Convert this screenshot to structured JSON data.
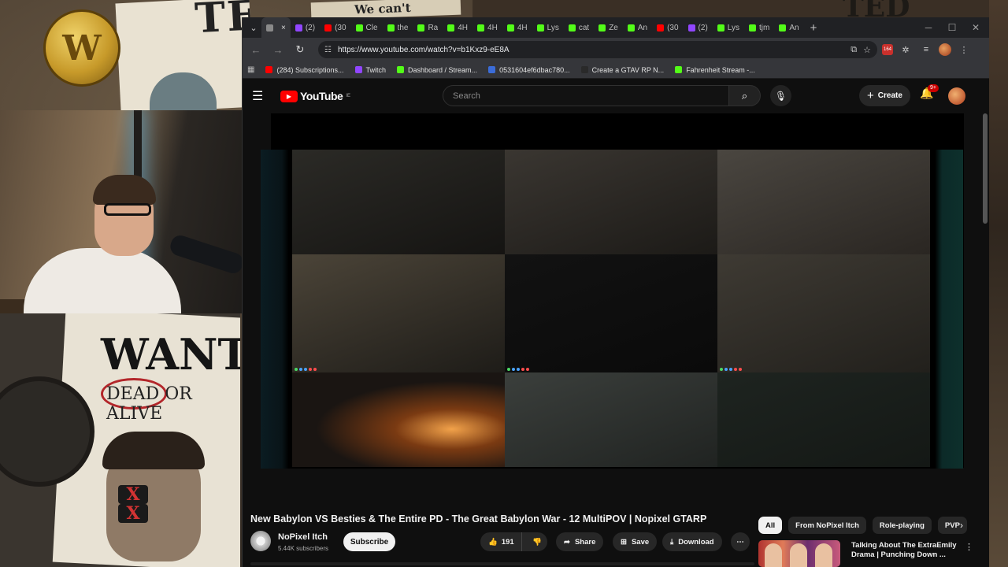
{
  "overlay": {
    "poster_top_text": "TED",
    "banner_text": "We can't expect",
    "logo_letter": "W",
    "top_right_text": "TED",
    "poster_bottom_wanted": "WANTE",
    "poster_bottom_sub": "DEAD OR ALIVE",
    "eyes_mark": "X"
  },
  "browser": {
    "tabs": [
      {
        "label": "",
        "favicon_color": "#8a8a8a",
        "active": true,
        "close": "×"
      },
      {
        "label": "(2)",
        "favicon_color": "#9146ff"
      },
      {
        "label": "(30",
        "favicon_color": "#ff0000"
      },
      {
        "label": "Cle",
        "favicon_color": "#53fc18"
      },
      {
        "label": "the",
        "favicon_color": "#53fc18"
      },
      {
        "label": "Ra",
        "favicon_color": "#53fc18"
      },
      {
        "label": "4H",
        "favicon_color": "#53fc18"
      },
      {
        "label": "4H",
        "favicon_color": "#53fc18"
      },
      {
        "label": "4H",
        "favicon_color": "#53fc18"
      },
      {
        "label": "Lys",
        "favicon_color": "#53fc18"
      },
      {
        "label": "cat",
        "favicon_color": "#53fc18"
      },
      {
        "label": "Ze",
        "favicon_color": "#53fc18"
      },
      {
        "label": "An",
        "favicon_color": "#53fc18"
      },
      {
        "label": "(30",
        "favicon_color": "#ff0000"
      },
      {
        "label": "(2)",
        "favicon_color": "#9146ff"
      },
      {
        "label": "Lys",
        "favicon_color": "#53fc18"
      },
      {
        "label": "tjm",
        "favicon_color": "#53fc18"
      },
      {
        "label": "An",
        "favicon_color": "#53fc18"
      }
    ],
    "new_tab": "+",
    "window_controls": {
      "minimize": "─",
      "maximize": "☐",
      "close": "✕"
    },
    "nav": {
      "back": "←",
      "forward": "→",
      "reload": "↻"
    },
    "url": "https://www.youtube.com/watch?v=b1Kxz9-eE8A",
    "bookmarks": [
      {
        "label": "(284) Subscriptions...",
        "favicon_color": "#ff0000"
      },
      {
        "label": "Twitch",
        "favicon_color": "#9146ff"
      },
      {
        "label": "Dashboard / Stream...",
        "favicon_color": "#53fc18"
      },
      {
        "label": "0531604ef6dbac780...",
        "favicon_color": "#3b6cd8"
      },
      {
        "label": "Create a GTAV RP N...",
        "favicon_color": "#2a2a2a"
      },
      {
        "label": "Fahrenheit Stream -...",
        "favicon_color": "#53fc18"
      }
    ]
  },
  "youtube": {
    "logo_word": "YouTube",
    "logo_region": "IE",
    "search_placeholder": "Search",
    "create_label": "Create",
    "notification_badge": "9+",
    "video_title": "New Babylon VS Besties & The Entire PD - The Great Babylon War - 12 MultiPOV | Nopixel GTARP",
    "channel_name": "NoPixel Itch",
    "subscribers": "5.44K subscribers",
    "subscribe_label": "Subscribe",
    "like_count": "191",
    "share_label": "Share",
    "save_label": "Save",
    "download_label": "Download",
    "chips": [
      "All",
      "From NoPixel Itch",
      "Role-playing",
      "PVP"
    ],
    "recommended": {
      "title": "Talking About The ExtraEmily Drama | Punching Down ..."
    }
  },
  "colors": {
    "yt_red": "#ff0000",
    "kick_green": "#53fc18",
    "twitch_purple": "#9146ff",
    "page_bg": "#0f0f0f"
  }
}
